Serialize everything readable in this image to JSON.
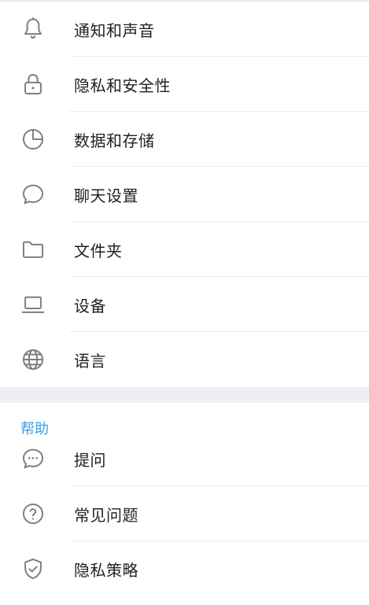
{
  "settings": {
    "items": [
      {
        "label": "通知和声音",
        "icon": "bell-icon"
      },
      {
        "label": "隐私和安全性",
        "icon": "lock-icon"
      },
      {
        "label": "数据和存储",
        "icon": "pie-chart-icon"
      },
      {
        "label": "聊天设置",
        "icon": "chat-bubble-icon"
      },
      {
        "label": "文件夹",
        "icon": "folder-icon"
      },
      {
        "label": "设备",
        "icon": "laptop-icon"
      },
      {
        "label": "语言",
        "icon": "globe-icon"
      }
    ]
  },
  "help": {
    "header": "帮助",
    "items": [
      {
        "label": "提问",
        "icon": "chat-ellipsis-icon"
      },
      {
        "label": "常见问题",
        "icon": "question-circle-icon"
      },
      {
        "label": "隐私策略",
        "icon": "shield-check-icon"
      }
    ]
  },
  "colors": {
    "accent": "#3a9ee4",
    "icon": "#7f7f7f",
    "text": "#222222",
    "divider": "#ececec",
    "section_bg": "#efeff3"
  }
}
